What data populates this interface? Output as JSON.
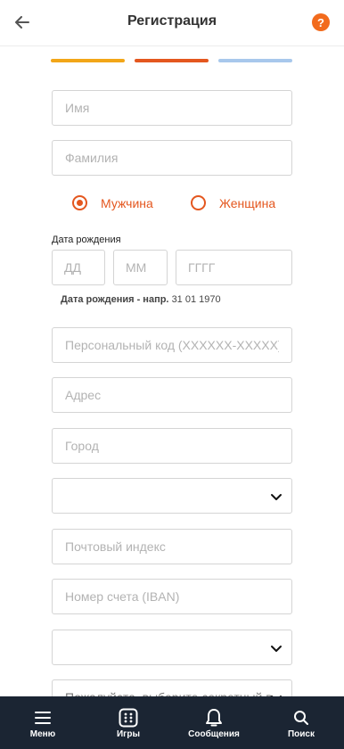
{
  "colors": {
    "accent": "#e4571f",
    "help": "#f26b1d",
    "step_done": "#f2a618",
    "step_active": "#e4571f",
    "step_next": "#a8c8ec",
    "nav_bg": "#1b2533"
  },
  "header": {
    "back_icon": "arrow-left-icon",
    "title": "Регистрация",
    "help_label": "?"
  },
  "progress": {
    "total_steps": 3,
    "current_step": 2
  },
  "form": {
    "first_name": {
      "placeholder": "Имя",
      "value": ""
    },
    "last_name": {
      "placeholder": "Фамилия",
      "value": ""
    },
    "gender": {
      "options": [
        {
          "label": "Мужчина",
          "selected": true
        },
        {
          "label": "Женщина",
          "selected": false
        }
      ]
    },
    "dob": {
      "label": "Дата рождения",
      "day_placeholder": "ДД",
      "month_placeholder": "ММ",
      "year_placeholder": "ГГГГ",
      "hint_bold": "Дата рождения - напр.",
      "hint_example": "31 01 1970"
    },
    "personal_code": {
      "placeholder": "Персональный код (XXXXXX-XXXXX)",
      "value": ""
    },
    "address": {
      "placeholder": "Адрес",
      "value": ""
    },
    "city": {
      "placeholder": "Город",
      "value": ""
    },
    "select_1": {
      "value": ""
    },
    "postal_code": {
      "placeholder": "Почтовый индекс",
      "value": ""
    },
    "iban": {
      "placeholder": "Номер счета (IBAN)",
      "value": ""
    },
    "select_2": {
      "value": ""
    },
    "secret_question": {
      "value": "Пожалуйста, выберите секретный в..."
    }
  },
  "bottom_nav": {
    "items": [
      {
        "label": "Меню",
        "icon": "menu-icon"
      },
      {
        "label": "Игры",
        "icon": "dice-icon"
      },
      {
        "label": "Сообщения",
        "icon": "bell-icon"
      },
      {
        "label": "Поиск",
        "icon": "search-icon"
      }
    ]
  }
}
